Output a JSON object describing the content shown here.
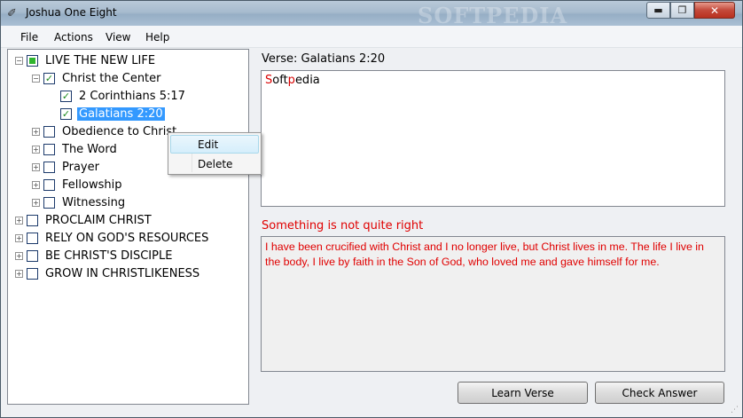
{
  "window": {
    "title": "Joshua One Eight",
    "watermark": "SOFTPEDIA"
  },
  "caption_buttons": {
    "minimize": "▬",
    "maximize": "❐",
    "close": "✕"
  },
  "menu": [
    "File",
    "Actions",
    "View",
    "Help"
  ],
  "tree": [
    {
      "label": "LIVE THE NEW LIFE",
      "state": "partial",
      "expander": "−"
    },
    {
      "label": "Christ the Center",
      "state": "checked",
      "expander": "−"
    },
    {
      "label": "2 Corinthians 5:17",
      "state": "checked",
      "expander": ""
    },
    {
      "label": "Galatians 2:20",
      "state": "checked",
      "expander": "",
      "selected": true
    },
    {
      "label": "Obedience to Christ",
      "state": "unchecked",
      "expander": "+"
    },
    {
      "label": "The Word",
      "state": "unchecked",
      "expander": "+"
    },
    {
      "label": "Prayer",
      "state": "unchecked",
      "expander": "+"
    },
    {
      "label": "Fellowship",
      "state": "unchecked",
      "expander": "+"
    },
    {
      "label": "Witnessing",
      "state": "unchecked",
      "expander": "+"
    },
    {
      "label": "PROCLAIM CHRIST",
      "state": "unchecked",
      "expander": "+"
    },
    {
      "label": "RELY ON GOD'S RESOURCES",
      "state": "unchecked",
      "expander": "+"
    },
    {
      "label": "BE CHRIST'S DISCIPLE",
      "state": "unchecked",
      "expander": "+"
    },
    {
      "label": "GROW IN CHRISTLIKENESS",
      "state": "unchecked",
      "expander": "+"
    }
  ],
  "context_menu": {
    "edit": "Edit",
    "delete": "Delete"
  },
  "verse": {
    "label": "Verse: Galatians 2:20",
    "input_red": "S",
    "input_black1": "oft",
    "input_red2": "p",
    "input_black2": "edia"
  },
  "feedback": {
    "warning": "Something is not quite right",
    "answer": "I have been crucified with Christ and I no longer live, but Christ lives in me. The life I live in the body, I live by faith in the Son of God, who loved me and gave himself for me."
  },
  "buttons": {
    "learn": "Learn Verse",
    "check": "Check Answer"
  },
  "colors": {
    "error": "#e00000",
    "selection": "#3399ff",
    "check": "#1b8a1b"
  }
}
